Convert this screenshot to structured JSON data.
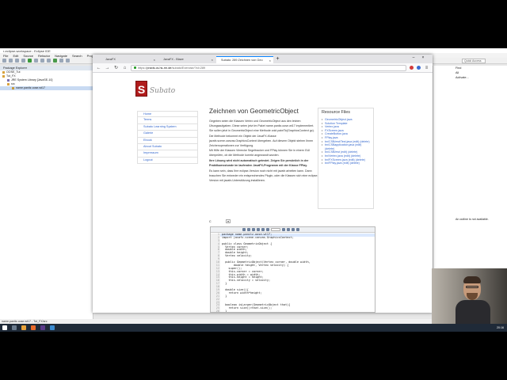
{
  "ide": {
    "title": "r-eclipse-workspace - Eclipse IDE",
    "menu": [
      "File",
      "Edit",
      "Source",
      "Refactor",
      "Navigate",
      "Search",
      "Project",
      "Run",
      "Window",
      "Help"
    ],
    "quick_access": "Quick Access",
    "package_explorer": {
      "tab": "Package Explorer",
      "items": [
        {
          "label": "OOSE_Tut",
          "indent": 0
        },
        {
          "label": "Tut_FX",
          "indent": 0
        },
        {
          "label": "JRE System Library [JavaSE-10]",
          "indent": 1
        },
        {
          "label": "src",
          "indent": 1
        },
        {
          "label": "name.panitz.oose.wt17",
          "indent": 2,
          "selected": true
        }
      ]
    },
    "right_panel": {
      "lines": [
        "Find",
        "All",
        "Activate..."
      ],
      "outline_message": "An outline is not available."
    },
    "status": "name.panitz.oose.wt17 - Tut_FX/src"
  },
  "browser": {
    "tabs": [
      {
        "label": "JavaFX",
        "active": false
      },
      {
        "label": "JavaFX - Blaze",
        "active": false
      },
      {
        "label": "Subato: 289 Zeichnen von Geo",
        "active": true
      }
    ],
    "url_prefix": "https://",
    "url_host": "praxis.cs.hs-rm.de",
    "url_path": "/subato/Exercise/?id=289",
    "colors": {
      "accent": "#0a84ff",
      "logo": "#b01c1c",
      "link": "#3366cc"
    }
  },
  "page": {
    "logo_letter": "S",
    "logo_text": "Subato",
    "nav": [
      "Home",
      "Terms",
      "Subato Learning System",
      "Galerie",
      "Ebook",
      "About Subato",
      "Impressum",
      "Logout"
    ],
    "heading": "Zeichnen von GeometricObject",
    "paragraphs": [
      "Gegeben seien die Klassen Vertex und GeometricObject aus den letzten Übungsaufgaben. Diese seien jetzt im Paket name.panitz.oose.wt17 implementiert. Sie sollen jetzt in GeometricObject eine Methode void paintTo(GraphicsContext gc).",
      "Die Methode bekommt ein Objekt der JavaFX-Klasse javafx.scene.canvas.GraphicsContext übergeben. Auf diesem Objekt stehen Ihnen Zeichenoperationen zur Verfügung.",
      "Mit Hilfe der Klassen Vierecke Segeltracker und FPlay können Sie in einem GUI überprüfen, ob die Methode korrekt angewandt wurden.",
      "Ihre Lösung wird nicht automatisch getestet. Zeigen Sie persönlich in der Praktikumsstunde im laufenden JavaFX-Programm mit der Klasse FPlay.",
      "Es kann sein, dass Ihre eclipse-Version noch nicht mit javafx arbeiten kann. Dann brauchen Sie entweder ein entsprechendes Plugin, oder die Klassen sich eine eclipse-Version mit javafx-Unterstützung installieren."
    ],
    "resources": {
      "title": "Resource Files",
      "items": [
        "GeometricObject.java",
        "Solution Template",
        "Vertex.java",
        "FXScreen.java",
        "CreateButton.java",
        "FPlay.java",
        "bn/CSB/ewt/Test.java (edit) (delete)",
        "bn/CSBapplication.java (edit) (delete)",
        "bn/CSB/ewt (edit) (delete)",
        "bn/Vertex.java (edit) (delete)",
        "bn/FXScreen.java (edit) (delete)",
        "bn/FPlay.java (edit) (delete)"
      ]
    },
    "language_select": "C",
    "code": [
      "package name.panitz.oose.wt17;",
      "import javafx.scene.canvas.GraphicsContext;",
      "",
      "public class GeometricObject {",
      "  Vertex corner;",
      "  double width;",
      "  double height;",
      "  Vertex velocity;",
      "",
      "  public GeometricObject(Vertex corner, double width,",
      "       double height, Vertex velocity) {",
      "    super();",
      "    this.corner = corner;",
      "    this.width = width;",
      "    this.height = height;",
      "    this.velocity = velocity;",
      "  }",
      "",
      "  double size(){",
      "    return width*height;",
      "  }",
      "",
      "",
      "  boolean isLarger(GeometricObject that){",
      "    return size()>that.size();",
      "  }"
    ]
  },
  "taskbar": {
    "clock": "20:16"
  }
}
